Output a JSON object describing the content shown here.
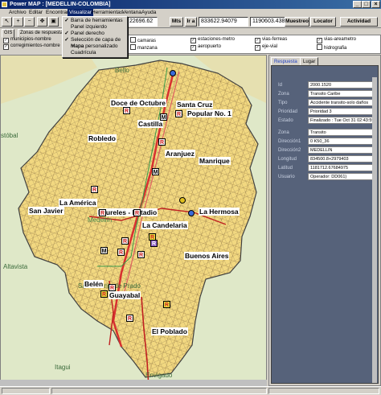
{
  "window": {
    "title": "Power MAP : [MEDELLIN-COLOMBIA]",
    "controls": [
      "_",
      "□",
      "×"
    ]
  },
  "menu": {
    "items": [
      "Archivo",
      "Editar",
      "Encontrar",
      "Visualizar",
      "Herramientas",
      "Ventana",
      "Ayuda"
    ],
    "active": "Visualizar"
  },
  "dropdown": {
    "items": [
      {
        "label": "Barra de herramientas",
        "checked": true
      },
      {
        "label": "Panel izquierdo",
        "checked": false
      },
      {
        "label": "Panel derecho",
        "checked": true
      },
      {
        "label": "Selección de capa de mapa",
        "checked": true
      },
      {
        "label": "Mapa personalizado",
        "checked": false
      },
      {
        "label": "Cuadrícula",
        "checked": false
      }
    ]
  },
  "toolbar": {
    "scale_value": "22696.62",
    "unit_label": "Mts",
    "go_label": "Ir a",
    "coord_x": "833622.94079",
    "coord_y": "1190603.43871",
    "buttons": {
      "muestreo": "Muestreo",
      "locator": "Locator",
      "actividad": "Actividad"
    }
  },
  "left_tabs": [
    "GIS",
    "Zonas de respuesta"
  ],
  "left_layers": [
    {
      "label": "municipios-nombre",
      "checked": true
    },
    {
      "label": "corregimientos-nombre",
      "checked": true
    }
  ],
  "layers": [
    {
      "label": "camaras",
      "checked": false
    },
    {
      "label": "manzana",
      "checked": false
    },
    {
      "label": "estaciones-metro",
      "checked": true
    },
    {
      "label": "aeropuerto",
      "checked": true
    },
    {
      "label": "vias-ferreas",
      "checked": true
    },
    {
      "label": "eje-vial",
      "checked": true
    },
    {
      "label": "vias-areametro",
      "checked": true
    },
    {
      "label": "hidrografia",
      "checked": false
    }
  ],
  "map": {
    "places": [
      "Doce de Octubre",
      "Santa Cruz",
      "Popular No. 1",
      "Castilla",
      "Robledo",
      "Aranjuez",
      "Manrique",
      "La América",
      "San Javier",
      "Laureles - Estadio",
      "La Hermosa",
      "La Candelaria",
      "Buenos Aires",
      "Belén",
      "Guayabal",
      "El Poblado"
    ],
    "outer": {
      "bello": "Bello",
      "san_cristobal": "stóbal",
      "altavista": "Altavista",
      "san_antonio": "San Antonio de Prado",
      "itagui": "Itagui",
      "envigado": "Envigado",
      "medellin": "Medellín"
    }
  },
  "right_panel": {
    "tabs": [
      "Respuesta",
      "Lugar"
    ],
    "active_tab": "Respuesta",
    "rows": [
      {
        "key": "Id",
        "value": "2000.1520"
      },
      {
        "key": "Zona",
        "value": "Transito Caribe"
      },
      {
        "key": "Tipo",
        "value": "Accidente transito-solo daños"
      },
      {
        "key": "Prioridad",
        "value": "Prioridad 3"
      },
      {
        "key": "Estado",
        "value": "Finalizado : Tue Oct 31 02:43:59 PM"
      },
      {
        "key": "Zona",
        "value": "Transito"
      },
      {
        "key": "Dirección1",
        "value": "0 K50_36"
      },
      {
        "key": "Dirección2",
        "value": "MEDELLIN"
      },
      {
        "key": "Longitud",
        "value": "834500.8+2979403"
      },
      {
        "key": "Latitud",
        "value": "1181712.67684975"
      },
      {
        "key": "Usuario",
        "value": "Operador: DD061)"
      }
    ]
  }
}
